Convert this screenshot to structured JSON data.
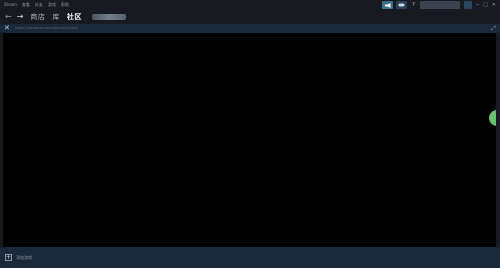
{
  "menu": {
    "items": [
      "Steam",
      "查看",
      "好友",
      "游戏",
      "帮助"
    ]
  },
  "topbar": {
    "announce_icon": "megaphone-icon",
    "controller_icon": "controller-icon",
    "help_label": "?",
    "account_label": "",
    "window_controls": [
      "─",
      "□",
      "✕"
    ]
  },
  "nav": {
    "back_icon": "←",
    "forward_icon": "→",
    "tabs": [
      {
        "label": "商店",
        "active": false
      },
      {
        "label": "库",
        "active": false
      },
      {
        "label": "社区",
        "active": true
      }
    ]
  },
  "urlbar": {
    "close_icon": "✕",
    "url": "https://steamcommunity.com/home/",
    "expand_icon": "⤢"
  },
  "bottombar": {
    "add_game_icon": "+",
    "add_game_label": "添加游戏"
  },
  "colors": {
    "chrome": "#171a21",
    "panel": "#1b2838",
    "content": "#000000",
    "accent": "#3d6c8d",
    "side_handle": "#6cc070"
  }
}
